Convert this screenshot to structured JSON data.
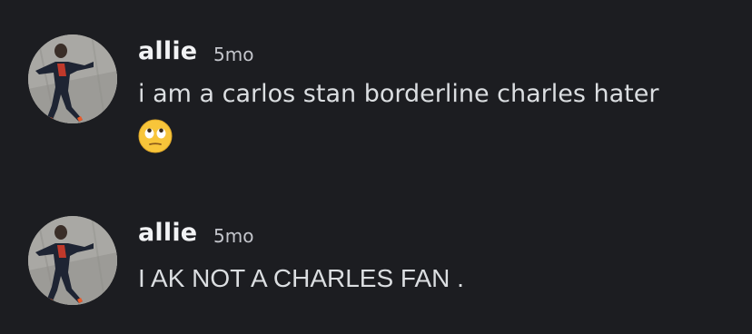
{
  "messages": [
    {
      "author": "allie",
      "timestamp": "5mo",
      "text": "i am a carlos stan borderline charles hater",
      "emoji": "🙄",
      "emoji_name": "face-with-rolling-eyes-icon"
    },
    {
      "author": "allie",
      "timestamp": "5mo",
      "text": "I AK NOT A CHARLES FAN ."
    }
  ],
  "colors": {
    "background": "#1c1d21",
    "username": "#f2f3f5",
    "message_text": "#dbdee1",
    "timestamp": "#c4c6cc"
  }
}
